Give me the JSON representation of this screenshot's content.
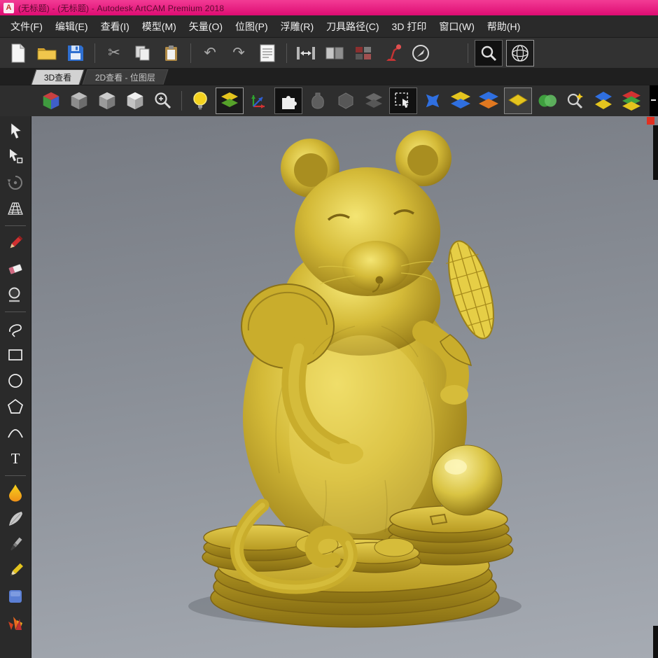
{
  "titlebar": {
    "app_icon_letter": "A",
    "title": "(无标题) - (无标题) - Autodesk ArtCAM Premium 2018",
    "accent_color": "#e5137d"
  },
  "menubar": {
    "items": [
      {
        "label": "文件(F)"
      },
      {
        "label": "编辑(E)"
      },
      {
        "label": "查看(I)"
      },
      {
        "label": "模型(M)"
      },
      {
        "label": "矢量(O)"
      },
      {
        "label": "位图(P)"
      },
      {
        "label": "浮雕(R)"
      },
      {
        "label": "刀具路径(C)"
      },
      {
        "label": "3D 打印"
      },
      {
        "label": "窗口(W)"
      },
      {
        "label": "帮助(H)"
      }
    ]
  },
  "view_tabs": {
    "active": "3D查看",
    "items": [
      {
        "label": "3D查看"
      },
      {
        "label": "2D查看 - 位图层"
      }
    ]
  },
  "icons": {
    "cut": "✂",
    "undo": "↶",
    "redo": "↷",
    "text_tool": "T"
  },
  "canvas": {
    "subject": "golden zodiac rat statue holding a corn cob, seated on stacks of coins beside a pearl ball",
    "model_color": "#d4ba38",
    "model_highlight": "#f4e573",
    "model_shadow": "#7e6712",
    "background_top": "#767a82",
    "background_bottom": "#a6abb3",
    "marker_color": "#e23020"
  }
}
